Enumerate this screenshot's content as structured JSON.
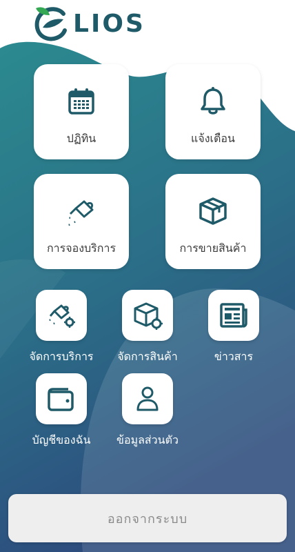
{
  "app": {
    "logo_text": "LIOS"
  },
  "tiles_large": [
    {
      "label": "ปฏิทิน",
      "icon": "calendar-icon"
    },
    {
      "label": "แจ้งเตือน",
      "icon": "bell-icon"
    },
    {
      "label": "การจองบริการ",
      "icon": "watering-can-icon"
    },
    {
      "label": "การขายสินค้า",
      "icon": "box-icon"
    }
  ],
  "tiles_small": [
    {
      "label": "จัดการบริการ",
      "icon": "watering-can-gear-icon"
    },
    {
      "label": "จัดการสินค้า",
      "icon": "box-gear-icon"
    },
    {
      "label": "ข่าวสาร",
      "icon": "newspaper-icon"
    },
    {
      "label": "บัญชีของฉัน",
      "icon": "wallet-icon"
    },
    {
      "label": "ข้อมูลส่วนตัว",
      "icon": "user-icon"
    }
  ],
  "logout_label": "ออกจากระบบ",
  "colors": {
    "primary": "#1f5a68",
    "gradient_top": "#2a8a8f",
    "gradient_bottom": "#2d4f7e",
    "logo_leaf": "#34a853"
  }
}
